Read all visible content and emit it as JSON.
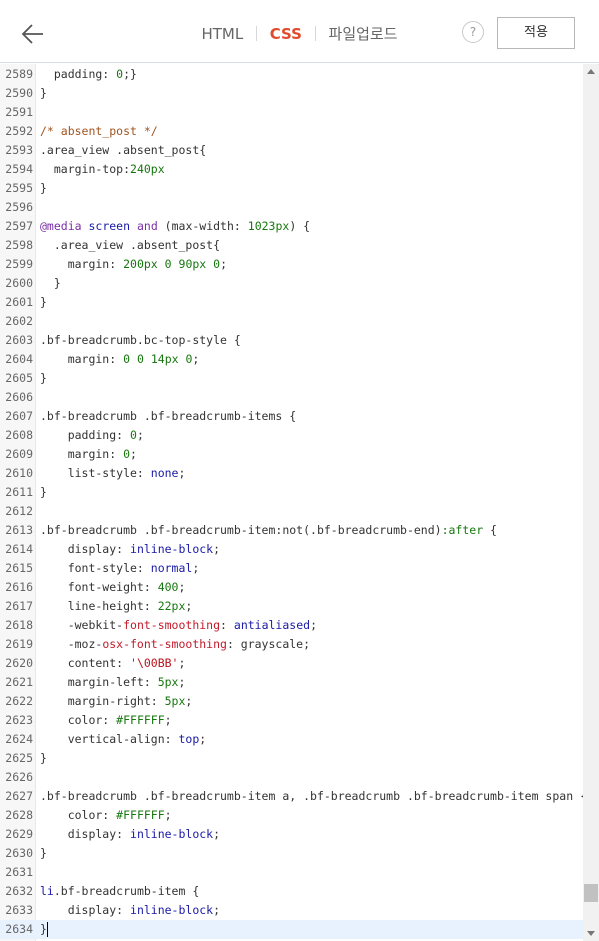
{
  "header": {
    "back_icon": "arrow-left-icon",
    "tabs": [
      {
        "label": "HTML",
        "active": false
      },
      {
        "label": "CSS",
        "active": true
      },
      {
        "label": "파일업로드",
        "active": false
      }
    ],
    "help_label": "?",
    "apply_label": "적용"
  },
  "editor": {
    "current_line": 2634,
    "scroll_position": 0.97,
    "lines": [
      {
        "n": "2589",
        "tokens": [
          [
            "sel",
            "  padding: "
          ],
          [
            "num",
            "0"
          ],
          [
            "sel",
            ";}"
          ]
        ]
      },
      {
        "n": "2590",
        "tokens": [
          [
            "sel",
            "}"
          ]
        ]
      },
      {
        "n": "2591",
        "tokens": []
      },
      {
        "n": "2592",
        "tokens": [
          [
            "com",
            "/* absent_post */"
          ]
        ]
      },
      {
        "n": "2593",
        "tokens": [
          [
            "sel",
            ".area_view .absent_post{"
          ]
        ]
      },
      {
        "n": "2594",
        "tokens": [
          [
            "sel",
            "  margin-top:"
          ],
          [
            "num",
            "240px"
          ]
        ]
      },
      {
        "n": "2595",
        "tokens": [
          [
            "sel",
            "}"
          ]
        ]
      },
      {
        "n": "2596",
        "tokens": []
      },
      {
        "n": "2597",
        "tokens": [
          [
            "at",
            "@media"
          ],
          [
            "sel",
            " "
          ],
          [
            "kw",
            "screen"
          ],
          [
            "sel",
            " "
          ],
          [
            "at",
            "and"
          ],
          [
            "sel",
            " (max-width: "
          ],
          [
            "num",
            "1023px"
          ],
          [
            "sel",
            ") {"
          ]
        ]
      },
      {
        "n": "2598",
        "tokens": [
          [
            "sel",
            "  .area_view .absent_post{"
          ]
        ]
      },
      {
        "n": "2599",
        "tokens": [
          [
            "sel",
            "    margin: "
          ],
          [
            "num",
            "200px"
          ],
          [
            "sel",
            " "
          ],
          [
            "num",
            "0"
          ],
          [
            "sel",
            " "
          ],
          [
            "num",
            "90px"
          ],
          [
            "sel",
            " "
          ],
          [
            "num",
            "0"
          ],
          [
            "sel",
            ";"
          ]
        ]
      },
      {
        "n": "2600",
        "tokens": [
          [
            "sel",
            "  }"
          ]
        ]
      },
      {
        "n": "2601",
        "tokens": [
          [
            "sel",
            "}"
          ]
        ]
      },
      {
        "n": "2602",
        "tokens": []
      },
      {
        "n": "2603",
        "tokens": [
          [
            "sel",
            ".bf-breadcrumb.bc-top-style {"
          ]
        ]
      },
      {
        "n": "2604",
        "tokens": [
          [
            "sel",
            "    margin: "
          ],
          [
            "num",
            "0"
          ],
          [
            "sel",
            " "
          ],
          [
            "num",
            "0"
          ],
          [
            "sel",
            " "
          ],
          [
            "num",
            "14px"
          ],
          [
            "sel",
            " "
          ],
          [
            "num",
            "0"
          ],
          [
            "sel",
            ";"
          ]
        ]
      },
      {
        "n": "2605",
        "tokens": [
          [
            "sel",
            "}"
          ]
        ]
      },
      {
        "n": "2606",
        "tokens": []
      },
      {
        "n": "2607",
        "tokens": [
          [
            "sel",
            ".bf-breadcrumb .bf-breadcrumb-items {"
          ]
        ]
      },
      {
        "n": "2608",
        "tokens": [
          [
            "sel",
            "    padding: "
          ],
          [
            "num",
            "0"
          ],
          [
            "sel",
            ";"
          ]
        ]
      },
      {
        "n": "2609",
        "tokens": [
          [
            "sel",
            "    margin: "
          ],
          [
            "num",
            "0"
          ],
          [
            "sel",
            ";"
          ]
        ]
      },
      {
        "n": "2610",
        "tokens": [
          [
            "sel",
            "    list-style: "
          ],
          [
            "kw",
            "none"
          ],
          [
            "sel",
            ";"
          ]
        ]
      },
      {
        "n": "2611",
        "tokens": [
          [
            "sel",
            "}"
          ]
        ]
      },
      {
        "n": "2612",
        "tokens": []
      },
      {
        "n": "2613",
        "tokens": [
          [
            "sel",
            ".bf-breadcrumb .bf-breadcrumb-item:not(.bf-breadcrumb-end)"
          ],
          [
            "ps",
            ":after"
          ],
          [
            "sel",
            " {"
          ]
        ]
      },
      {
        "n": "2614",
        "tokens": [
          [
            "sel",
            "    display: "
          ],
          [
            "kw",
            "inline-block"
          ],
          [
            "sel",
            ";"
          ]
        ]
      },
      {
        "n": "2615",
        "tokens": [
          [
            "sel",
            "    font-style: "
          ],
          [
            "kw",
            "normal"
          ],
          [
            "sel",
            ";"
          ]
        ]
      },
      {
        "n": "2616",
        "tokens": [
          [
            "sel",
            "    font-weight: "
          ],
          [
            "num",
            "400"
          ],
          [
            "sel",
            ";"
          ]
        ]
      },
      {
        "n": "2617",
        "tokens": [
          [
            "sel",
            "    line-height: "
          ],
          [
            "num",
            "22px"
          ],
          [
            "sel",
            ";"
          ]
        ]
      },
      {
        "n": "2618",
        "tokens": [
          [
            "sel",
            "    -webkit-"
          ],
          [
            "prop",
            "font-smoothing"
          ],
          [
            "sel",
            ": "
          ],
          [
            "kw",
            "antialiased"
          ],
          [
            "sel",
            ";"
          ]
        ]
      },
      {
        "n": "2619",
        "tokens": [
          [
            "sel",
            "    -moz-"
          ],
          [
            "prop",
            "osx-font-smoothing"
          ],
          [
            "sel",
            ": grayscale;"
          ]
        ]
      },
      {
        "n": "2620",
        "tokens": [
          [
            "sel",
            "    content: "
          ],
          [
            "str",
            "'\\00BB'"
          ],
          [
            "sel",
            ";"
          ]
        ]
      },
      {
        "n": "2621",
        "tokens": [
          [
            "sel",
            "    margin-left: "
          ],
          [
            "num",
            "5px"
          ],
          [
            "sel",
            ";"
          ]
        ]
      },
      {
        "n": "2622",
        "tokens": [
          [
            "sel",
            "    margin-right: "
          ],
          [
            "num",
            "5px"
          ],
          [
            "sel",
            ";"
          ]
        ]
      },
      {
        "n": "2623",
        "tokens": [
          [
            "sel",
            "    color: "
          ],
          [
            "num",
            "#FFFFFF"
          ],
          [
            "sel",
            ";"
          ]
        ]
      },
      {
        "n": "2624",
        "tokens": [
          [
            "sel",
            "    vertical-align: "
          ],
          [
            "kw",
            "top"
          ],
          [
            "sel",
            ";"
          ]
        ]
      },
      {
        "n": "2625",
        "tokens": [
          [
            "sel",
            "}"
          ]
        ]
      },
      {
        "n": "2626",
        "tokens": []
      },
      {
        "n": "2627",
        "tokens": [
          [
            "sel",
            ".bf-breadcrumb .bf-breadcrumb-item a, .bf-breadcrumb .bf-breadcrumb-item span {"
          ]
        ]
      },
      {
        "n": "2628",
        "tokens": [
          [
            "sel",
            "    color: "
          ],
          [
            "num",
            "#FFFFFF"
          ],
          [
            "sel",
            ";"
          ]
        ]
      },
      {
        "n": "2629",
        "tokens": [
          [
            "sel",
            "    display: "
          ],
          [
            "kw",
            "inline-block"
          ],
          [
            "sel",
            ";"
          ]
        ]
      },
      {
        "n": "2630",
        "tokens": [
          [
            "sel",
            "}"
          ]
        ]
      },
      {
        "n": "2631",
        "tokens": []
      },
      {
        "n": "2632",
        "tokens": [
          [
            "tag",
            "li"
          ],
          [
            "sel",
            ".bf-breadcrumb-item {"
          ]
        ]
      },
      {
        "n": "2633",
        "tokens": [
          [
            "sel",
            "    display: "
          ],
          [
            "kw",
            "inline-block"
          ],
          [
            "sel",
            ";"
          ]
        ]
      },
      {
        "n": "2634",
        "tokens": [
          [
            "sel",
            "}"
          ]
        ]
      }
    ]
  },
  "colors": {
    "accent": "#e24a2c",
    "comment": "#a0541f",
    "at_rule": "#7b2ea6",
    "number": "#16770e",
    "keyword": "#1a1aa6",
    "property": "#c21b2a",
    "current_line_bg": "#e8f2ff"
  }
}
